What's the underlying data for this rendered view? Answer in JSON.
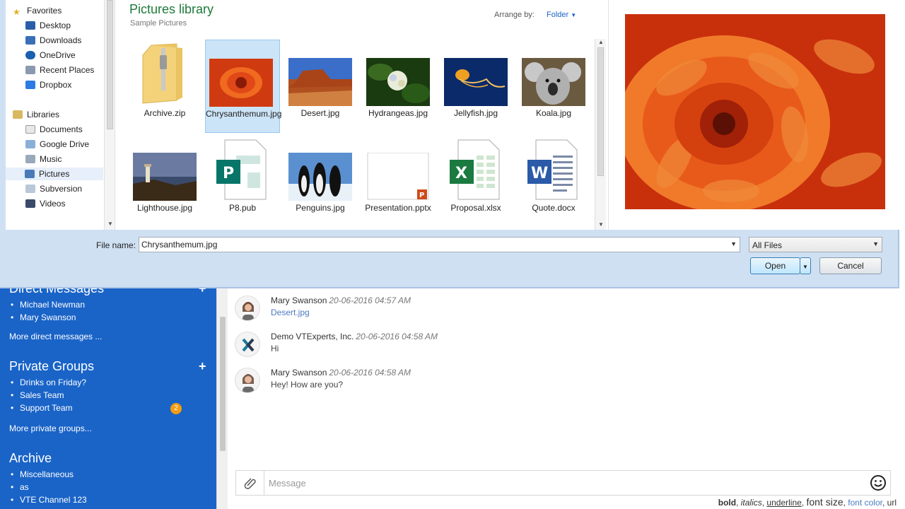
{
  "dialog": {
    "favorites": {
      "header": "Favorites",
      "items": [
        "Desktop",
        "Downloads",
        "OneDrive",
        "Recent Places",
        "Dropbox"
      ]
    },
    "libraries": {
      "header": "Libraries",
      "items": [
        "Documents",
        "Google Drive",
        "Music",
        "Pictures",
        "Subversion",
        "Videos"
      ],
      "selected": "Pictures"
    },
    "library_title": "Pictures library",
    "library_subtitle": "Sample Pictures",
    "arrange_label": "Arrange by:",
    "arrange_value": "Folder",
    "files": [
      {
        "label": "Archive.zip",
        "icon": "zip-folder-icon"
      },
      {
        "label": "Chrysanthemum.jpg",
        "icon": "chrysanthemum-thumbnail",
        "selected": true
      },
      {
        "label": "Desert.jpg",
        "icon": "desert-thumbnail"
      },
      {
        "label": "Hydrangeas.jpg",
        "icon": "hydrangeas-thumbnail"
      },
      {
        "label": "Jellyfish.jpg",
        "icon": "jellyfish-thumbnail"
      },
      {
        "label": "Koala.jpg",
        "icon": "koala-thumbnail"
      },
      {
        "label": "Lighthouse.jpg",
        "icon": "lighthouse-thumbnail"
      },
      {
        "label": "P8.pub",
        "icon": "publisher-file-icon"
      },
      {
        "label": "Penguins.jpg",
        "icon": "penguins-thumbnail"
      },
      {
        "label": "Presentation.pptx",
        "icon": "powerpoint-file-icon"
      },
      {
        "label": "Proposal.xlsx",
        "icon": "excel-file-icon"
      },
      {
        "label": "Quote.docx",
        "icon": "word-file-icon"
      }
    ],
    "file_name_label": "File name:",
    "file_name_value": "Chrysanthemum.jpg",
    "file_type_value": "All Files",
    "open_label": "Open",
    "cancel_label": "Cancel"
  },
  "chat": {
    "sections": {
      "direct_messages": {
        "header": "Direct Messages",
        "items": [
          "Michael Newman",
          "Mary Swanson"
        ],
        "more": "More direct messages ..."
      },
      "private_groups": {
        "header": "Private Groups",
        "items": [
          "Drinks on Friday?",
          "Sales Team",
          "Support Team"
        ],
        "more": "More private groups...",
        "badge": "2"
      },
      "archive": {
        "header": "Archive",
        "items": [
          "Miscellaneous",
          "as",
          "VTE Channel 123"
        ]
      }
    },
    "messages": [
      {
        "author": "Mary Swanson",
        "time": "20-06-2016 04:57 AM",
        "text": "Desert.jpg",
        "is_link": true
      },
      {
        "author": "Demo VTExperts, Inc.",
        "time": "20-06-2016 04:58 AM",
        "text": "Hi"
      },
      {
        "author": "Mary Swanson",
        "time": "20-06-2016 04:58 AM",
        "text": "Hey! How are you?"
      }
    ],
    "composer_placeholder": "Message",
    "formatting": {
      "bold": "bold",
      "italics": "italics",
      "underline": "underline",
      "font_size": "font size",
      "font_color": "font color",
      "url": "url"
    }
  },
  "colors": {
    "sidebar_blue": "#1a64c8",
    "library_green": "#1e7a3a",
    "badge_orange": "#f39c12",
    "selection": "#cce4f7"
  }
}
